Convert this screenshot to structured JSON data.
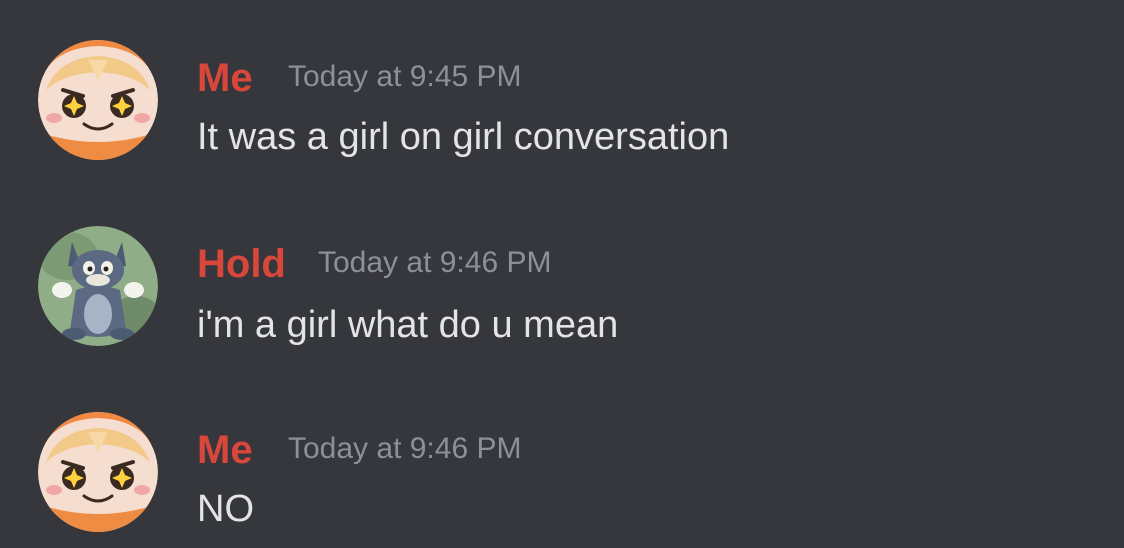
{
  "messages": [
    {
      "author": "Me",
      "timestamp": "Today at 9:45 PM",
      "text": "It was a girl on girl conversation",
      "avatar": "umaru-chibi-avatar",
      "author_color": "#d8473a"
    },
    {
      "author": "Hold",
      "timestamp": "Today at 9:46 PM",
      "text": "i'm a girl what do u mean",
      "avatar": "cartoon-cat-avatar",
      "author_color": "#d8473a"
    },
    {
      "author": "Me",
      "timestamp": "Today at 9:46 PM",
      "text": "NO",
      "avatar": "umaru-chibi-avatar",
      "author_color": "#d8473a"
    }
  ],
  "theme": {
    "background": "#36373d",
    "text": "#e3e4e8",
    "timestamp": "#8e9097"
  }
}
